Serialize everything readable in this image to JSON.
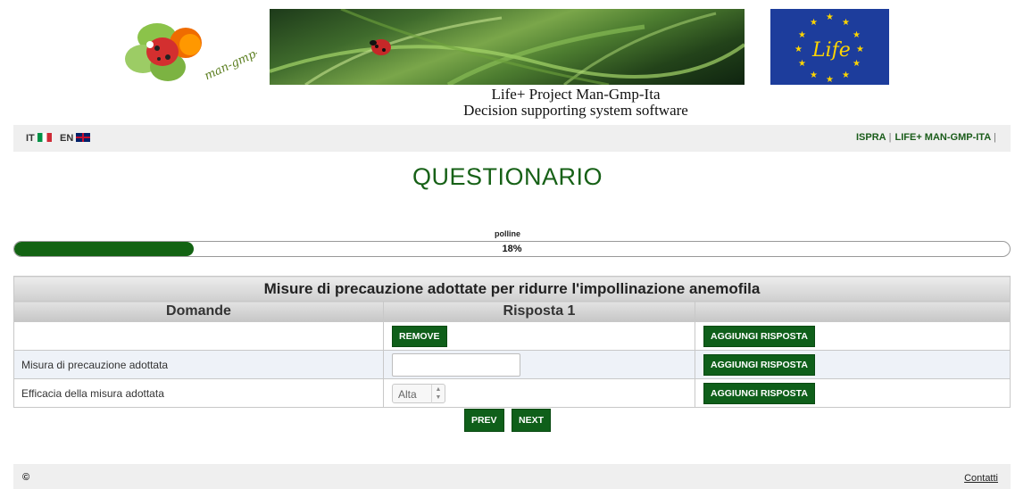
{
  "header": {
    "logo_text": "man-gmp-ita",
    "eu_logo_text": "Life",
    "subtitle_line1": "Life+ Project Man-Gmp-Ita",
    "subtitle_line2": "Decision supporting system software"
  },
  "nav": {
    "lang_it": "IT",
    "lang_en": "EN",
    "link_ispra": "ISPRA",
    "link_life": "LIFE+ MAN-GMP-ITA",
    "separator": "|"
  },
  "page_title": "QUESTIONARIO",
  "progress": {
    "label": "polline",
    "percent_text": "18%",
    "value": 0.18
  },
  "table": {
    "caption": "Misure di precauzione adottate per ridurre l'impollinazione anemofila",
    "col_questions": "Domande",
    "col_answer1": "Risposta 1",
    "col_extra": "",
    "remove_label": "REMOVE",
    "add_label": "AGGIUNGI RISPOSTA",
    "rows": [
      {
        "question": "Misura di precauzione adottata",
        "input_value": ""
      },
      {
        "question": "Efficacia della misura adottata",
        "select_value": "Alta"
      }
    ]
  },
  "pager": {
    "prev": "PREV",
    "next": "NEXT"
  },
  "footer": {
    "copyright": "©",
    "contact": "Contatti"
  },
  "colors": {
    "brand_green": "#0f5f1a",
    "title_green": "#176117",
    "progress_fill": "#136313"
  }
}
